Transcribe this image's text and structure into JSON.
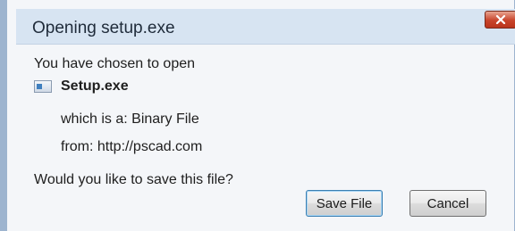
{
  "dialog": {
    "title": "Opening setup.exe",
    "close_symbol": "×",
    "intro": "You have chosen to open",
    "file_name": "Setup.exe",
    "file_icon": "application-file-icon",
    "type_line": "which is a: Binary File",
    "source_line": "from: http://pscad.com",
    "question": "Would you like to save this file?",
    "save_label": "Save File",
    "cancel_label": "Cancel"
  }
}
